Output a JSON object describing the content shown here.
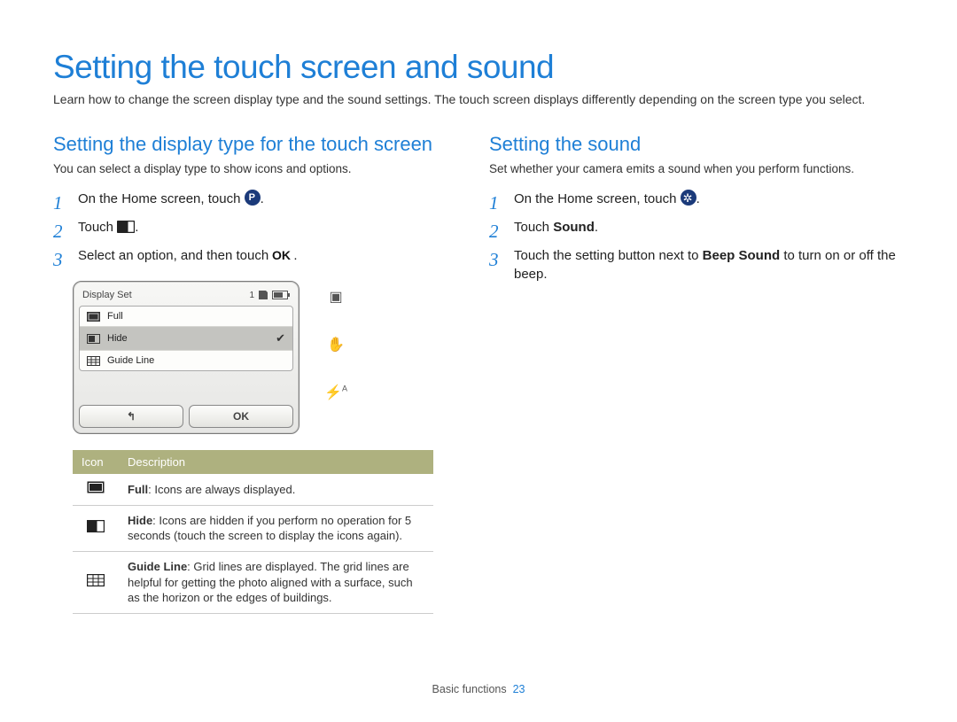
{
  "title": "Setting the touch screen and sound",
  "intro": "Learn how to change the screen display type and the sound settings. The touch screen displays differently depending on the screen type you select.",
  "left": {
    "heading": "Setting the display type for the touch screen",
    "intro": "You can select a display type to show icons and options.",
    "steps": {
      "s1a": "On the Home screen, touch ",
      "s1b": ".",
      "s2a": "Touch ",
      "s2b": ".",
      "s3a": "Select an option, and then touch ",
      "s3b": "."
    },
    "ui": {
      "title": "Display Set",
      "count": "1",
      "optFull": "Full",
      "optHide": "Hide",
      "optGuide": "Guide Line",
      "back": "↰",
      "ok": "OK"
    },
    "table": {
      "hIcon": "Icon",
      "hDesc": "Description",
      "r1": "Full: Icons are always displayed.",
      "r1b": "Full",
      "r1t": ": Icons are always displayed.",
      "r2b": "Hide",
      "r2t": ": Icons are hidden if you perform no operation for 5 seconds (touch the screen to display the icons again).",
      "r3b": "Guide Line",
      "r3t": ": Grid lines are displayed. The grid lines are helpful for getting the photo aligned with a surface, such as the horizon or the edges of buildings."
    }
  },
  "right": {
    "heading": "Setting the sound",
    "intro": "Set whether your camera emits a sound when you perform functions.",
    "steps": {
      "s1a": "On the Home screen, touch ",
      "s1b": ".",
      "s2a": "Touch ",
      "s2b": "Sound",
      "s2c": ".",
      "s3a": "Touch the setting button next to ",
      "s3b": "Beep Sound",
      "s3c": " to turn on or off the beep."
    }
  },
  "footer": {
    "section": "Basic functions",
    "page": "23"
  }
}
